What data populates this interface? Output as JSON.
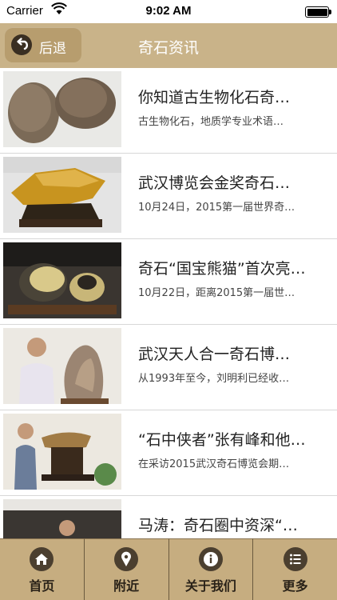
{
  "status_bar": {
    "carrier": "Carrier",
    "time": "9:02 AM"
  },
  "nav": {
    "back_label": "后退",
    "title": "奇石资讯"
  },
  "articles": [
    {
      "title": "你知道古生物化石奇…",
      "summary": "古生物化石，地质学专业术语…"
    },
    {
      "title": "武汉博览会金奖奇石…",
      "summary": "10月24日，2015第一届世界奇…"
    },
    {
      "title": "奇石“国宝熊猫”首次亮…",
      "summary": "10月22日，距离2015第一届世…"
    },
    {
      "title": "武汉天人合一奇石博…",
      "summary": "从1993年至今，刘明利已经收…"
    },
    {
      "title": "“石中侠者”张有峰和他…",
      "summary": "在采访2015武汉奇石博览会期…"
    },
    {
      "title": "马涛：奇石圈中资深“…",
      "summary": ""
    }
  ],
  "tabs": [
    {
      "label": "首页",
      "icon": "home-icon"
    },
    {
      "label": "附近",
      "icon": "location-pin-icon"
    },
    {
      "label": "关于我们",
      "icon": "info-icon"
    },
    {
      "label": "更多",
      "icon": "list-icon"
    }
  ],
  "colors": {
    "nav_bg": "#c9b389",
    "tab_bg": "#c6ad80",
    "icon_dark": "#4b3f2f"
  }
}
